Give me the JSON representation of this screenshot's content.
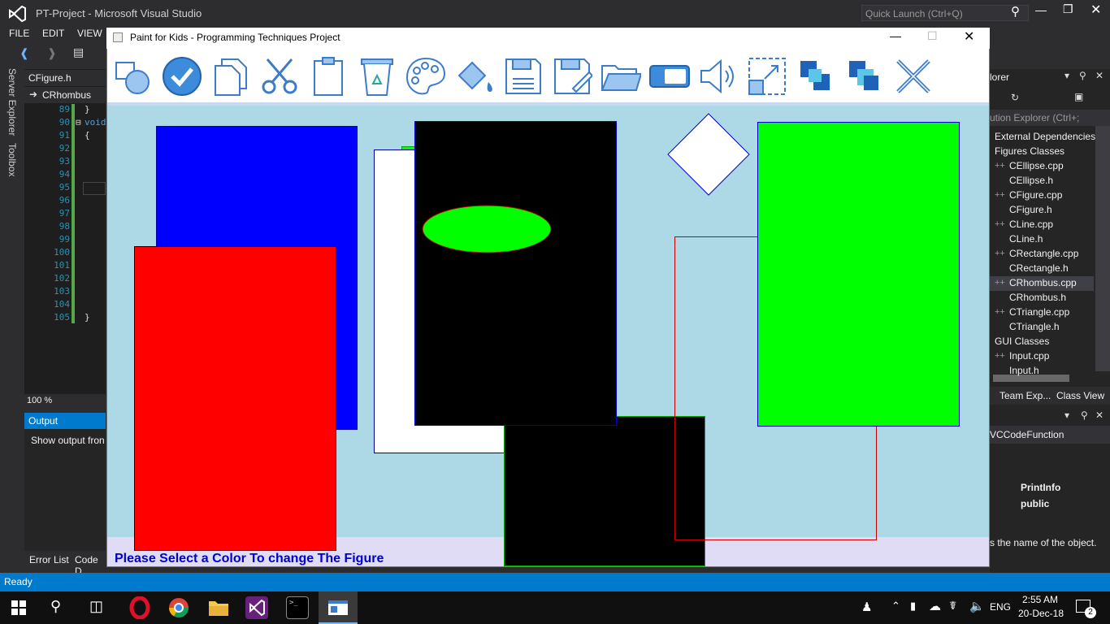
{
  "vs": {
    "title": "PT-Project - Microsoft Visual Studio",
    "quick_launch": "Quick Launch (Ctrl+Q)",
    "menu": [
      "FILE",
      "EDIT",
      "VIEW"
    ],
    "file_tab": "CFigure.h",
    "member_dropdown": "CRhombus",
    "side_tabs": [
      "Server Explorer",
      "Toolbox"
    ],
    "line_numbers": [
      "89",
      "90",
      "91",
      "92",
      "93",
      "94",
      "95",
      "96",
      "97",
      "98",
      "99",
      "100",
      "101",
      "102",
      "103",
      "104",
      "105"
    ],
    "code_fragments": {
      "brace_close": "}",
      "void": "void",
      "brace_open": "{",
      "brace_end": "}"
    },
    "zoom": "100 %",
    "output_title": "Output",
    "output_text": "Show output fron",
    "bottom_tabs": [
      "Error List",
      "Code D"
    ],
    "status": "Ready"
  },
  "solution": {
    "header": "lorer",
    "toolbar_label": "ution Explorer (Ctrl+;",
    "items": [
      {
        "label": "External Dependencies",
        "child": false,
        "cpp": false
      },
      {
        "label": "Figures Classes",
        "child": false,
        "cpp": false
      },
      {
        "label": "CEllipse.cpp",
        "child": true,
        "cpp": true
      },
      {
        "label": "CEllipse.h",
        "child": true,
        "cpp": false
      },
      {
        "label": "CFigure.cpp",
        "child": true,
        "cpp": true
      },
      {
        "label": "CFigure.h",
        "child": true,
        "cpp": false
      },
      {
        "label": "CLine.cpp",
        "child": true,
        "cpp": true
      },
      {
        "label": "CLine.h",
        "child": true,
        "cpp": false
      },
      {
        "label": "CRectangle.cpp",
        "child": true,
        "cpp": true
      },
      {
        "label": "CRectangle.h",
        "child": true,
        "cpp": false
      },
      {
        "label": "CRhombus.cpp",
        "child": true,
        "cpp": true,
        "selected": true
      },
      {
        "label": "CRhombus.h",
        "child": true,
        "cpp": false
      },
      {
        "label": "CTriangle.cpp",
        "child": true,
        "cpp": true
      },
      {
        "label": "CTriangle.h",
        "child": true,
        "cpp": false
      },
      {
        "label": "GUI Classes",
        "child": false,
        "cpp": false
      },
      {
        "label": "Input.cpp",
        "child": true,
        "cpp": true
      },
      {
        "label": "Input.h",
        "child": true,
        "cpp": false
      }
    ],
    "tabs": [
      "Team Exp...",
      "Class View"
    ],
    "props_object": "VCCodeFunction",
    "props_rows": [
      "PrintInfo",
      "public"
    ],
    "props_desc": "s the name of the object."
  },
  "paint": {
    "title": "Paint for Kids - Programming Techniques Project",
    "tools": [
      "select-shapes-icon",
      "check-icon",
      "copy-icon",
      "cut-icon",
      "paste-icon",
      "recycle-bin-icon",
      "palette-icon",
      "fill-bucket-icon",
      "save-icon",
      "save-as-icon",
      "open-folder-icon",
      "toggle-mode-icon",
      "sound-icon",
      "resize-icon",
      "bring-front-icon",
      "send-back-icon",
      "exit-icon"
    ],
    "status_message": "Please Select a Color To change The Figure",
    "colors": {
      "canvas": "#add8e6",
      "status_bg": "#e0dcf5",
      "status_text": "#0000cc"
    }
  },
  "taskbar": {
    "lang": "ENG",
    "time": "2:55 AM",
    "date": "20-Dec-18",
    "notifications": "2"
  }
}
